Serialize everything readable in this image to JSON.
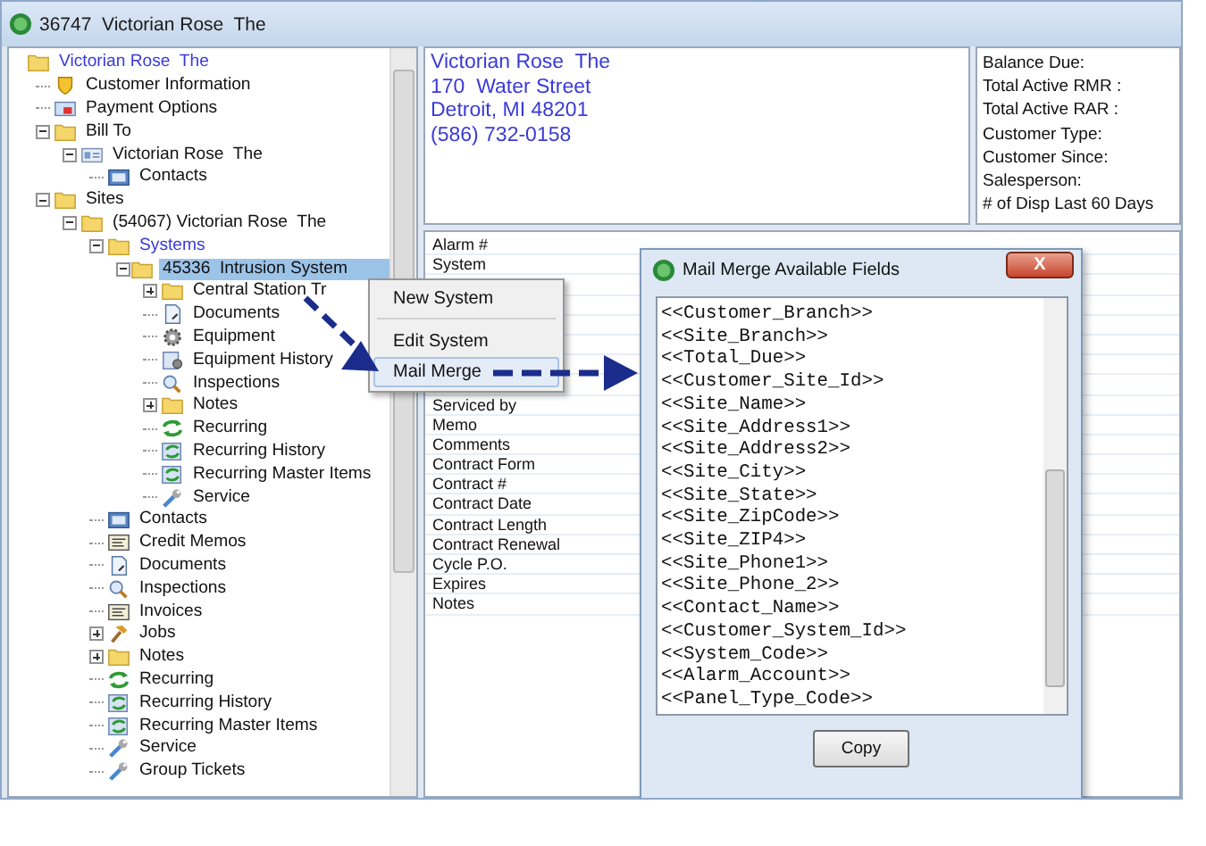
{
  "window": {
    "title": "36747  Victorian Rose  The"
  },
  "tree": {
    "items": [
      {
        "label": "Victorian Rose  The",
        "kind": "folder",
        "link": true,
        "selected": false,
        "children": [
          {
            "label": "Customer Information",
            "kind": "shield",
            "selected": false
          },
          {
            "label": "Payment Options",
            "kind": "card",
            "selected": false
          },
          {
            "label": "Bill To",
            "kind": "folder",
            "expanded": true,
            "selected": false,
            "children": [
              {
                "label": "Victorian Rose  The",
                "kind": "idcard",
                "expanded": true,
                "selected": false,
                "children": [
                  {
                    "label": "Contacts",
                    "kind": "contacts",
                    "selected": false
                  }
                ]
              }
            ]
          },
          {
            "label": "Sites",
            "kind": "folder",
            "expanded": true,
            "selected": false,
            "children": [
              {
                "label": "(54067) Victorian Rose  The",
                "kind": "folder",
                "expanded": true,
                "selected": false,
                "children": [
                  {
                    "label": "Systems",
                    "kind": "folder",
                    "link": true,
                    "expanded": true,
                    "selected": false,
                    "children": [
                      {
                        "label": "45336  Intrusion System",
                        "kind": "folder",
                        "expanded": true,
                        "selected": true,
                        "children": [
                          {
                            "label": "Central Station Tr",
                            "kind": "folder",
                            "expanded": false,
                            "selected": false
                          },
                          {
                            "label": "Documents",
                            "kind": "document",
                            "selected": false
                          },
                          {
                            "label": "Equipment",
                            "kind": "gear",
                            "selected": false
                          },
                          {
                            "label": "Equipment History",
                            "kind": "gearpage",
                            "selected": false
                          },
                          {
                            "label": "Inspections",
                            "kind": "magnifier",
                            "selected": false
                          },
                          {
                            "label": "Notes",
                            "kind": "folder",
                            "expanded": false,
                            "selected": false
                          },
                          {
                            "label": "Recurring",
                            "kind": "recurring",
                            "selected": false
                          },
                          {
                            "label": "Recurring History",
                            "kind": "recurpage",
                            "selected": false
                          },
                          {
                            "label": "Recurring Master Items",
                            "kind": "recurpage",
                            "selected": false
                          },
                          {
                            "label": "Service",
                            "kind": "wrench",
                            "selected": false
                          }
                        ]
                      }
                    ]
                  },
                  {
                    "label": "Contacts",
                    "kind": "contacts",
                    "selected": false
                  },
                  {
                    "label": "Credit Memos",
                    "kind": "memo",
                    "selected": false
                  },
                  {
                    "label": "Documents",
                    "kind": "document",
                    "selected": false
                  },
                  {
                    "label": "Inspections",
                    "kind": "magnifier",
                    "selected": false
                  },
                  {
                    "label": "Invoices",
                    "kind": "memo",
                    "selected": false
                  },
                  {
                    "label": "Jobs",
                    "kind": "hammer",
                    "expanded": false,
                    "selected": false
                  },
                  {
                    "label": "Notes",
                    "kind": "folder",
                    "expanded": false,
                    "selected": false
                  },
                  {
                    "label": "Recurring",
                    "kind": "recurring",
                    "selected": false
                  },
                  {
                    "label": "Recurring History",
                    "kind": "recurpage",
                    "selected": false
                  },
                  {
                    "label": "Recurring Master Items",
                    "kind": "recurpage",
                    "selected": false
                  },
                  {
                    "label": "Service",
                    "kind": "wrench",
                    "selected": false
                  },
                  {
                    "label": "Group Tickets",
                    "kind": "wrench",
                    "selected": false
                  }
                ]
              }
            ]
          }
        ]
      }
    ]
  },
  "address": [
    "Victorian Rose  The",
    "170  Water Street",
    "Detroit, MI 48201",
    "(586) 732-0158"
  ],
  "summary": [
    "Balance Due:",
    "Total Active RMR :",
    "Total Active RAR :",
    "Customer Type:",
    "Customer Since:",
    "Salesperson:",
    "# of Disp Last 60 Days"
  ],
  "properties_top": [
    {
      "label": "Alarm #"
    },
    {
      "label": "System"
    }
  ],
  "properties": [
    {
      "label": "Serviced by"
    },
    {
      "label": "Memo"
    },
    {
      "label": "Comments"
    },
    {
      "label": "Contract Form"
    },
    {
      "label": "Contract #"
    },
    {
      "label": "Contract Date"
    },
    {
      "label": "Contract Length"
    },
    {
      "label": "Contract Renewal"
    },
    {
      "label": "Cycle P.O."
    },
    {
      "label": "Expires"
    },
    {
      "label": "Notes"
    }
  ],
  "context_menu": {
    "items": [
      {
        "label": "New System",
        "selected": false,
        "separator_after": true
      },
      {
        "label": "Edit System",
        "selected": false,
        "separator_after": false
      },
      {
        "label": "Mail Merge",
        "selected": true,
        "separator_after": false
      }
    ]
  },
  "dialog": {
    "title": "Mail Merge Available Fields",
    "close": "X",
    "fields": [
      "<<Customer_Branch>>",
      "<<Site_Branch>>",
      "<<Total_Due>>",
      "<<Customer_Site_Id>>",
      "<<Site_Name>>",
      "<<Site_Address1>>",
      "<<Site_Address2>>",
      "<<Site_City>>",
      "<<Site_State>>",
      "<<Site_ZipCode>>",
      "<<Site_ZIP4>>",
      "<<Site_Phone1>>",
      "<<Site_Phone_2>>",
      "<<Contact_Name>>",
      "<<Customer_System_Id>>",
      "<<System_Code>>",
      "<<Alarm_Account>>",
      "<<Panel_Type_Code>>"
    ],
    "button": "Copy"
  }
}
